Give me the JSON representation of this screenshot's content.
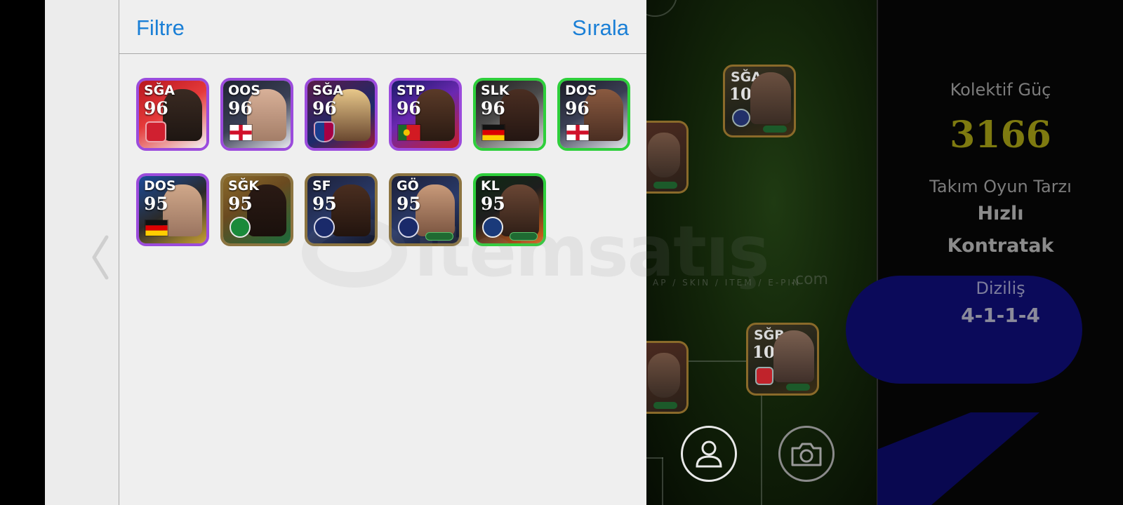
{
  "panel": {
    "filter_label": "Filtre",
    "sort_label": "Sırala"
  },
  "reserves": [
    {
      "pos": "SĞA",
      "ovr": "96",
      "emblem": "arsenal-crest-icon",
      "flag": "",
      "frame": "purple"
    },
    {
      "pos": "OOS",
      "ovr": "96",
      "emblem": "",
      "flag": "england-flag-icon",
      "frame": "purple"
    },
    {
      "pos": "SĞA",
      "ovr": "96",
      "emblem": "barcelona-crest-icon",
      "flag": "",
      "frame": "purple"
    },
    {
      "pos": "STP",
      "ovr": "96",
      "emblem": "",
      "flag": "portugal-flag-icon",
      "frame": "purple"
    },
    {
      "pos": "SLK",
      "ovr": "96",
      "emblem": "",
      "flag": "germany-flag-icon",
      "frame": "green"
    },
    {
      "pos": "DOS",
      "ovr": "96",
      "emblem": "",
      "flag": "england-flag-icon",
      "frame": "green"
    },
    {
      "pos": "DOS",
      "ovr": "95",
      "emblem": "",
      "flag": "germany-flag-icon",
      "frame": "purple"
    },
    {
      "pos": "SĞK",
      "ovr": "95",
      "emblem": "celtic-crest-icon",
      "flag": "",
      "frame": "gold"
    },
    {
      "pos": "SF",
      "ovr": "95",
      "emblem": "psg-crest-icon",
      "flag": "",
      "frame": "gold"
    },
    {
      "pos": "GÖ",
      "ovr": "95",
      "emblem": "psg-crest-icon",
      "flag": "",
      "frame": "gold"
    },
    {
      "pos": "KL",
      "ovr": "95",
      "emblem": "club-crest-icon",
      "flag": "",
      "frame": "green"
    }
  ],
  "field_players": [
    {
      "pos": "SĞA",
      "ovr": "102",
      "emblem": "inter-crest-icon"
    },
    {
      "pos": "SĞB",
      "ovr": "102",
      "emblem": "arsenal-crest-icon"
    }
  ],
  "team_stats": {
    "power_label": "Kolektif Güç",
    "power_value": "3166",
    "style_label": "Takım Oyun Tarzı",
    "style_value_line1": "Hızlı",
    "style_value_line2": "Kontratak",
    "formation_label": "Diziliş",
    "formation_value": "4-1-1-4"
  },
  "watermark": {
    "brand": "itemsatış",
    "tagline": "AP / SKIN / ITEM / E-PIN",
    "domain": ".com"
  },
  "colors": {
    "link_blue": "#1a7fd6",
    "power_gold": "#7e7a10",
    "formation_navy": "#0b0a5a",
    "frame_purple": "#9b4bdc",
    "frame_green": "#2ecf3b",
    "frame_gold": "#8c7440"
  },
  "icons": [
    "back-chevron-icon",
    "profile-icon",
    "camera-icon"
  ]
}
